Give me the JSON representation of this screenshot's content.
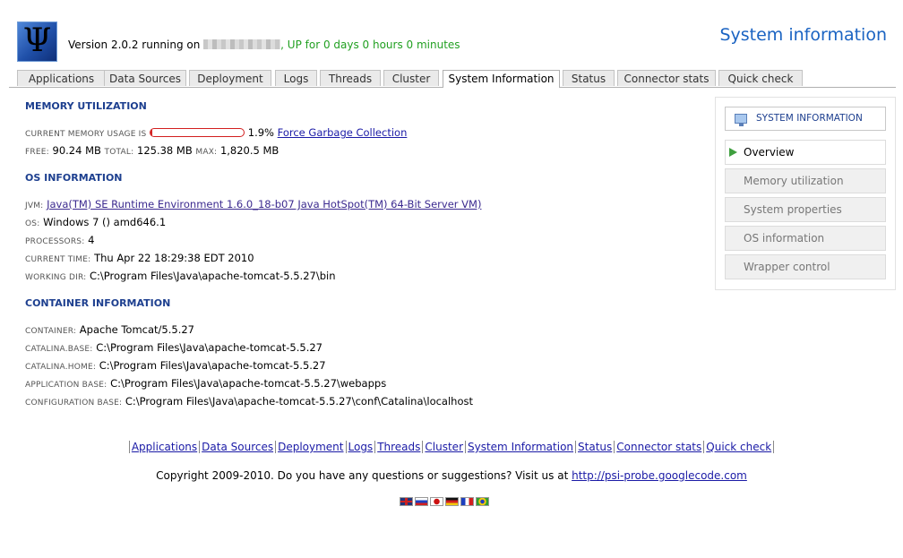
{
  "header": {
    "logo_glyph": "Ψ",
    "version_text": "Version 2.0.2 running on ",
    "uptime_text": ", UP for 0 days 0 hours 0 minutes",
    "page_heading": "System information"
  },
  "tabs": [
    {
      "label": "Applications"
    },
    {
      "label": "Data Sources"
    },
    {
      "label": "Deployment"
    },
    {
      "label": "Logs"
    },
    {
      "label": "Threads"
    },
    {
      "label": "Cluster"
    },
    {
      "label": "System Information",
      "active": true
    },
    {
      "label": "Status"
    },
    {
      "label": "Connector stats"
    },
    {
      "label": "Quick check"
    }
  ],
  "memory": {
    "title": "MEMORY UTILIZATION",
    "usage_label": "CURRENT MEMORY USAGE IS",
    "usage_percent": "1.9%",
    "usage_fraction": 0.019,
    "gc_link": "Force Garbage Collection",
    "free_label": "FREE:",
    "free_value": "90.24 MB",
    "total_label": "TOTAL:",
    "total_value": "125.38 MB",
    "max_label": "MAX:",
    "max_value": "1,820.5 MB"
  },
  "os": {
    "title": "OS INFORMATION",
    "jvm_label": "JVM:",
    "jvm_value": " Java(TM) SE Runtime Environment  1.6.0_18-b07  Java HotSpot(TM) 64-Bit Server VM)",
    "os_label": "OS:",
    "os_value": "Windows 7 () amd646.1",
    "processors_label": "PROCESSORS:",
    "processors_value": "4",
    "time_label": "CURRENT TIME:",
    "time_value": "Thu Apr 22 18:29:38 EDT 2010",
    "workdir_label": "WORKING DIR:",
    "workdir_value": "C:\\Program Files\\Java\\apache-tomcat-5.5.27\\bin"
  },
  "container": {
    "title": "CONTAINER INFORMATION",
    "container_label": "CONTAINER:",
    "container_value": "Apache Tomcat/5.5.27",
    "cbase_label": "CATALINA.BASE:",
    "cbase_value": "C:\\Program Files\\Java\\apache-tomcat-5.5.27",
    "chome_label": "CATALINA.HOME:",
    "chome_value": "C:\\Program Files\\Java\\apache-tomcat-5.5.27",
    "appbase_label": "APPLICATION BASE:",
    "appbase_value": "C:\\Program Files\\Java\\apache-tomcat-5.5.27\\webapps",
    "confbase_label": "CONFIGURATION BASE:",
    "confbase_value": "C:\\Program Files\\Java\\apache-tomcat-5.5.27\\conf\\Catalina\\localhost"
  },
  "sidebar": {
    "heading": "SYSTEM INFORMATION",
    "heading_icon": "monitor-icon",
    "items": [
      {
        "label": "Overview",
        "active": true
      },
      {
        "label": "Memory utilization"
      },
      {
        "label": "System properties"
      },
      {
        "label": "OS information"
      },
      {
        "label": "Wrapper control"
      }
    ]
  },
  "footer": {
    "nav": [
      "Applications",
      "Data Sources",
      "Deployment",
      "Logs",
      "Threads",
      "Cluster",
      "System Information",
      "Status",
      "Connector stats",
      "Quick check"
    ],
    "copyright": "Copyright 2009-2010. Do you have any questions or suggestions? Visit us at ",
    "url": "http://psi-probe.googlecode.com",
    "flags": [
      "uk-flag-icon",
      "russia-flag-icon",
      "japan-flag-icon",
      "germany-flag-icon",
      "france-flag-icon",
      "brazil-flag-icon"
    ]
  },
  "colors": {
    "heading_blue": "#1a63c2",
    "section_blue": "#1d3f8f",
    "uptime_green": "#22a022",
    "memory_bar_red": "#d21f1f"
  }
}
